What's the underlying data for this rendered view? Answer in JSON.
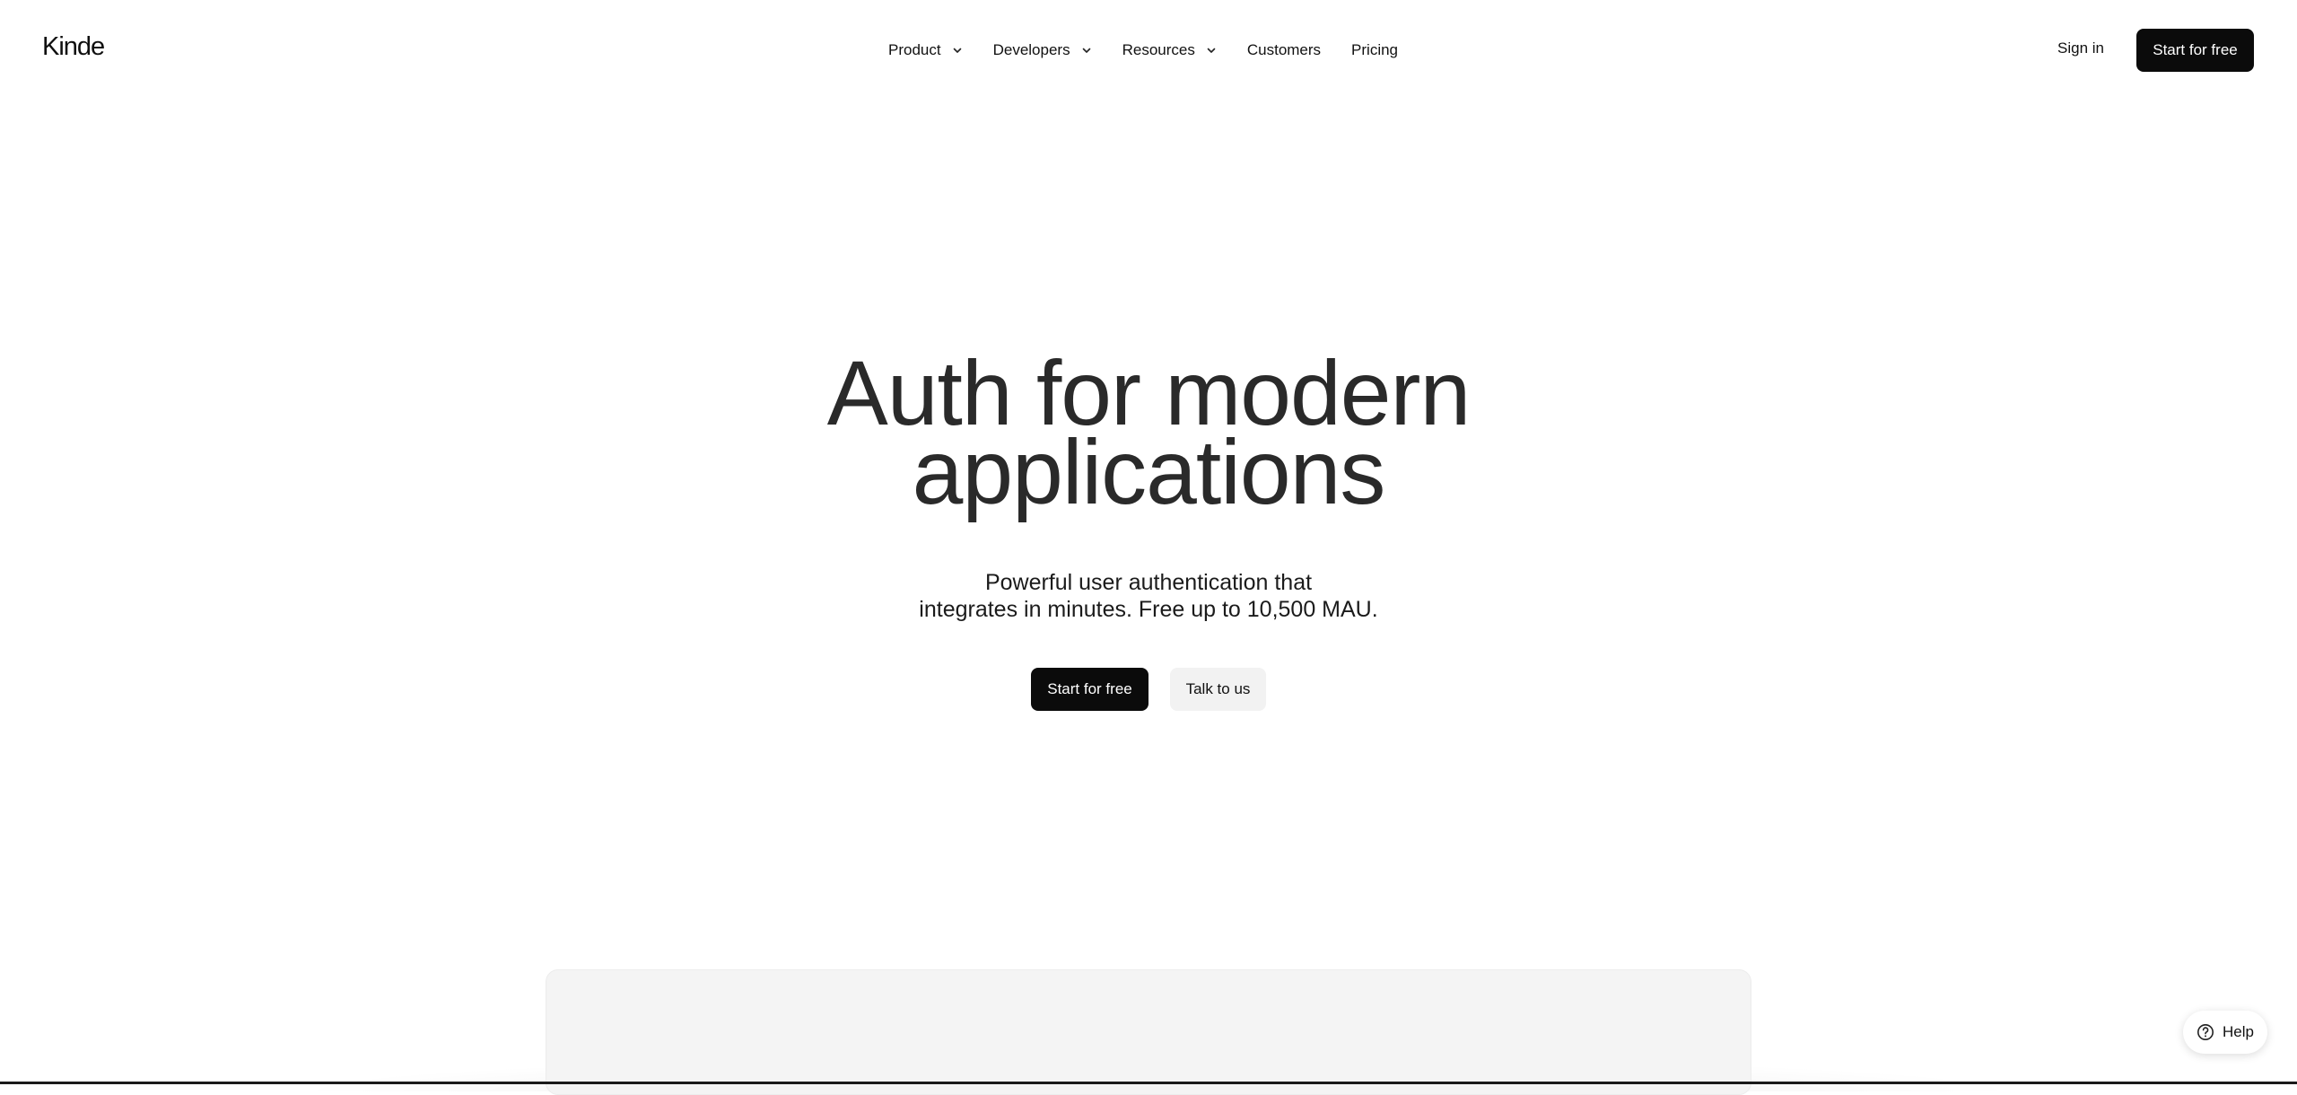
{
  "brand": {
    "logo_text": "Kinde"
  },
  "nav": {
    "items": [
      {
        "label": "Product",
        "icon": "chevron-down-icon"
      },
      {
        "label": "Developers",
        "icon": "chevron-down-icon"
      },
      {
        "label": "Resources",
        "icon": "chevron-down-icon"
      },
      {
        "label": "Customers"
      },
      {
        "label": "Pricing"
      }
    ],
    "sign_in": "Sign in",
    "cta": "Start for free"
  },
  "hero": {
    "title_line1": "Auth for modern",
    "title_line2": "applications",
    "subtitle_line1": "Powerful user authentication that",
    "subtitle_line2": "integrates in minutes. Free up to 10,500 MAU.",
    "primary_cta": "Start for free",
    "secondary_cta": "Talk to us"
  },
  "help": {
    "label": "Help",
    "icon": "question-circle-icon"
  },
  "colors": {
    "primary_button": "#0b0b0b",
    "secondary_button": "#f2f2f2",
    "heading_text": "#2a2a2a",
    "preview_panel": "#f4f4f4"
  }
}
